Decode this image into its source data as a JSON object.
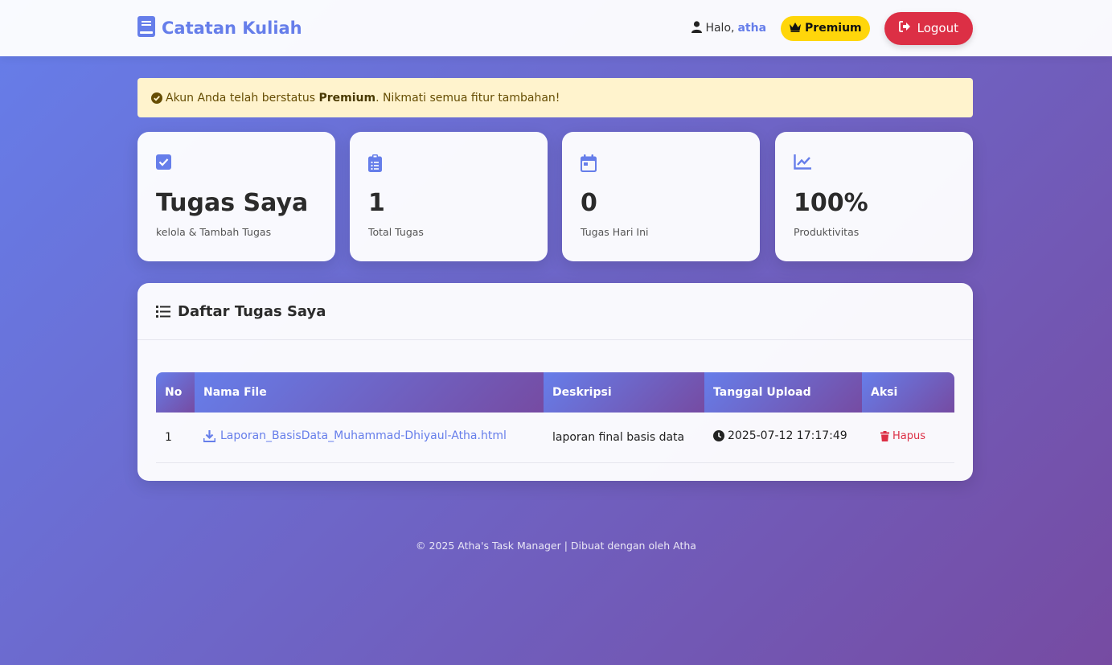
{
  "navbar": {
    "brand": "Catatan Kuliah",
    "greeting": "Halo,",
    "username": "atha",
    "badge": "Premium",
    "logout": "Logout"
  },
  "alert": {
    "prefix": "Akun Anda telah berstatus",
    "strong": "Premium",
    "suffix": ". Nikmati semua fitur tambahan!"
  },
  "stats": [
    {
      "icon": "check-square-icon",
      "value": "Tugas Saya",
      "label": "kelola & Tambah Tugas"
    },
    {
      "icon": "clipboard-list-icon",
      "value": "1",
      "label": "Total Tugas"
    },
    {
      "icon": "calendar-icon",
      "value": "0",
      "label": "Tugas Hari Ini"
    },
    {
      "icon": "chart-line-icon",
      "value": "100%",
      "label": "Produktivitas"
    }
  ],
  "tasks": {
    "title": "Daftar Tugas Saya",
    "columns": [
      "No",
      "Nama File",
      "Deskripsi",
      "Tanggal Upload",
      "Aksi"
    ],
    "rows": [
      {
        "no": "1",
        "file": "Laporan_BasisData_Muhammad-Dhiyaul-Atha.html",
        "desc": "laporan final basis data",
        "date": "2025-07-12 17:17:49",
        "action": "Hapus"
      }
    ]
  },
  "footer": "© 2025 Atha's Task Manager | Dibuat dengan oleh Atha",
  "colors": {
    "accent": "#667eea",
    "gradient_end": "#764ba2",
    "danger": "#dc2f45",
    "premium": "#ffd60a",
    "alert_bg": "#fff3cd"
  }
}
